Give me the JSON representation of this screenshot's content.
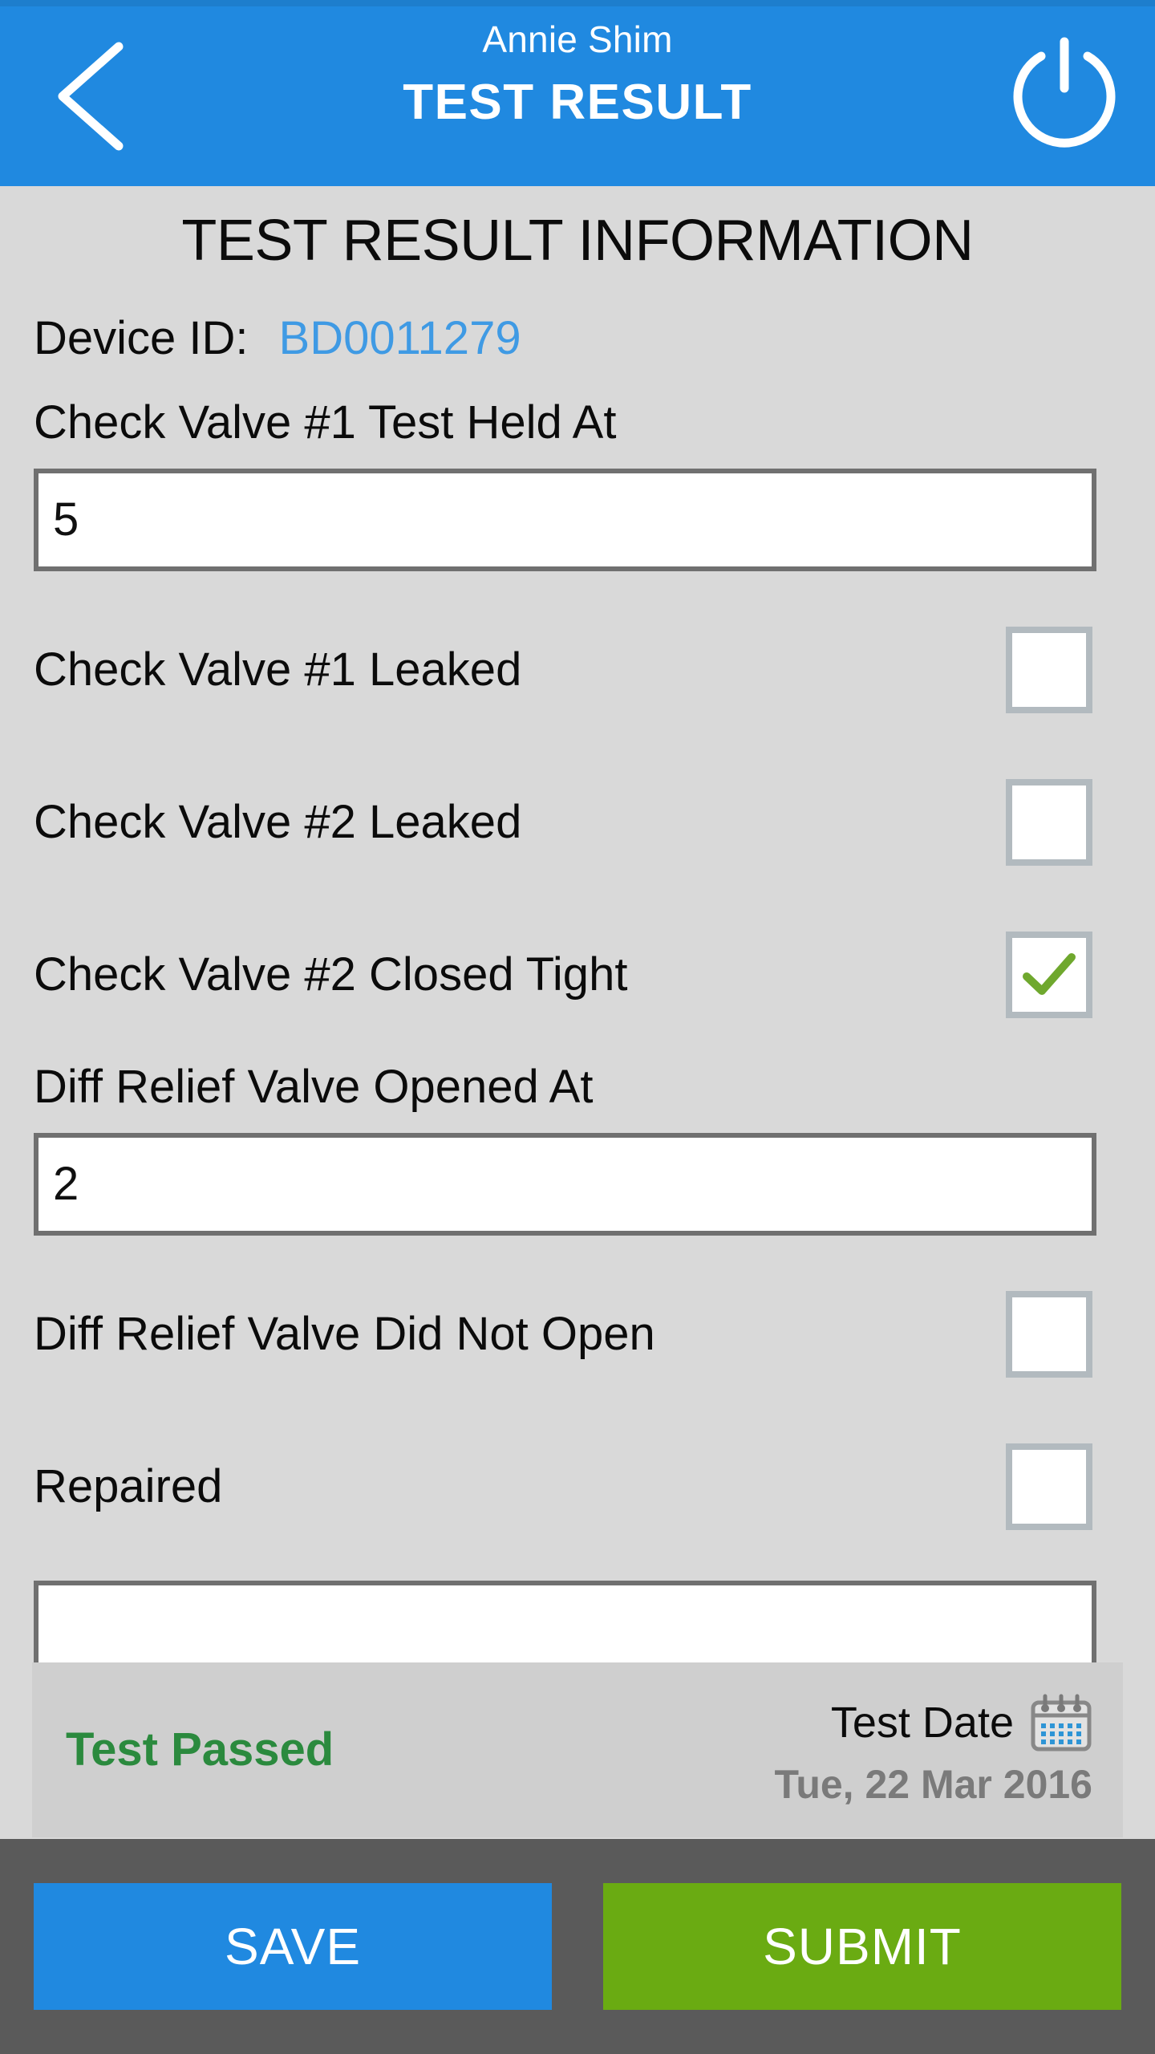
{
  "header": {
    "user_name": "Annie Shim",
    "screen_title": "TEST RESULT",
    "back_icon": "chevron-left-icon",
    "power_icon": "power-icon",
    "background_color": "#2089e0"
  },
  "section": {
    "title": "TEST RESULT INFORMATION"
  },
  "device": {
    "label": "Device ID:",
    "value": "BD0011279",
    "value_color": "#3f9ae4"
  },
  "fields": {
    "cv1_held_label": "Check Valve #1 Test Held At",
    "cv1_held_value": "5",
    "drv_opened_label": "Diff Relief Valve Opened At",
    "drv_opened_value": "2",
    "trailing_input_value": ""
  },
  "checkboxes": {
    "cv1_leaked_label": "Check Valve #1 Leaked",
    "cv1_leaked_checked": "false",
    "cv2_leaked_label": "Check Valve #2 Leaked",
    "cv2_leaked_checked": "false",
    "cv2_closed_tight_label": "Check Valve #2 Closed Tight",
    "cv2_closed_tight_checked": "true",
    "drv_not_open_label": "Diff Relief Valve Did Not Open",
    "drv_not_open_checked": "false",
    "repaired_label": "Repaired",
    "repaired_checked": "false",
    "check_color": "#6fa82e",
    "border_color": "#b2babf"
  },
  "status": {
    "result_text": "Test Passed",
    "result_color": "#2b8a3e",
    "date_label": "Test Date",
    "date_value": "Tue, 22 Mar 2016",
    "calendar_icon": "calendar-icon"
  },
  "footer": {
    "save_label": "SAVE",
    "save_color": "#2089e0",
    "submit_label": "SUBMIT",
    "submit_color": "#6aab12",
    "bar_color": "#5a5a5a"
  }
}
